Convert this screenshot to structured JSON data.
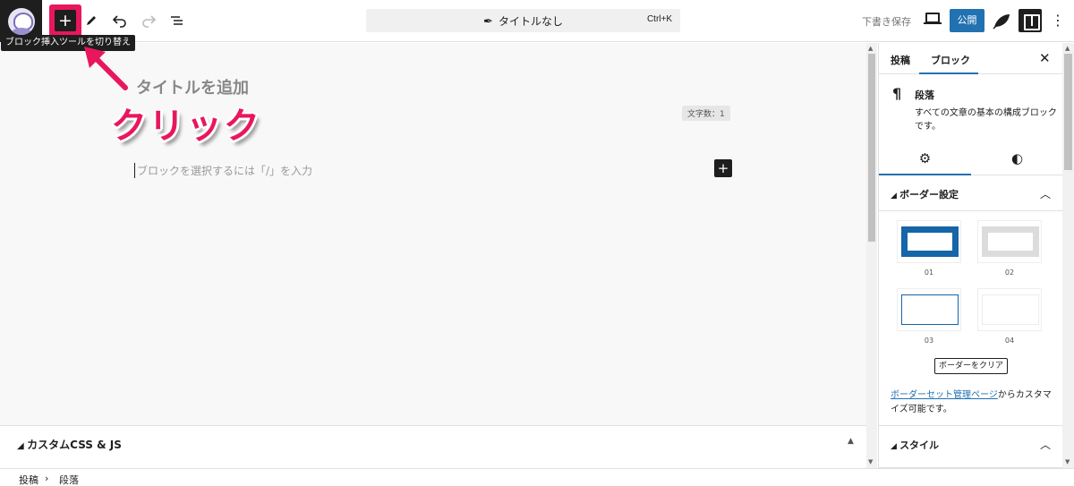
{
  "topbar": {
    "tools": {
      "inserter_icon": "plus-icon",
      "edit_icon": "pencil-icon",
      "undo_icon": "undo-icon",
      "redo_icon": "redo-icon",
      "outline_icon": "list-view-icon"
    },
    "tooltip": "ブロック挿入ツールを切り替え",
    "command": {
      "title": "タイトルなし",
      "shortcut": "Ctrl+K"
    },
    "save_draft": "下書き保存",
    "publish": "公開"
  },
  "annotation": {
    "label": "クリック",
    "color": "#e8175d"
  },
  "editor": {
    "title_placeholder": "タイトルを追加",
    "word_count": "文字数：1",
    "paragraph_placeholder": "ブロックを選択するには「/」を入力"
  },
  "metabox": {
    "title": "カスタムCSS & JS"
  },
  "breadcrumb": [
    "投稿",
    "段落"
  ],
  "sidebar": {
    "tabs": [
      "投稿",
      "ブロック"
    ],
    "block": {
      "name": "段落",
      "description": "すべての文章の基本の構成ブロックです。"
    },
    "border_panel": {
      "title": "ボーダー設定",
      "options": [
        "01",
        "02",
        "03",
        "04"
      ],
      "clear_label": "ボーダーをクリア",
      "note_link": "ボーダーセット管理ページ",
      "note_text": "からカスタマイズ可能です。"
    },
    "style_panel": {
      "title": "スタイル"
    }
  },
  "colors": {
    "accent": "#2271b1",
    "highlight": "#e8175d",
    "dark": "#1e1e1e"
  }
}
